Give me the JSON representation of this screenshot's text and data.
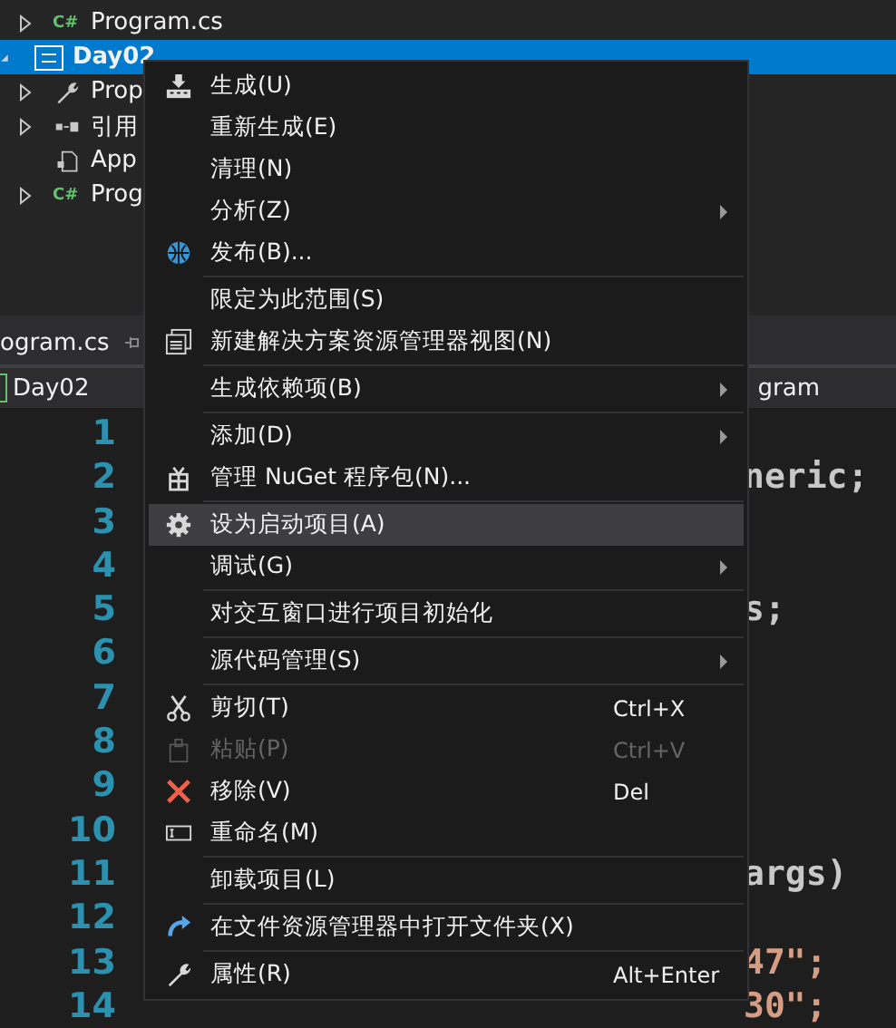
{
  "solution_tree": [
    {
      "label": "Program.cs",
      "kind": "csfile",
      "badge": "C#",
      "expanded": false,
      "selected": false
    },
    {
      "label": "Day02",
      "kind": "project",
      "expanded": true,
      "selected": true,
      "children": [
        {
          "label": "Prop",
          "kind": "properties",
          "expanded": false,
          "selected": false
        },
        {
          "label": "引用",
          "kind": "references",
          "expanded": false,
          "selected": false
        },
        {
          "label": "App",
          "kind": "config",
          "selected": false
        },
        {
          "label": "Prog",
          "kind": "csfile",
          "badge": "C#",
          "expanded": false,
          "selected": false
        }
      ]
    }
  ],
  "editor_tab": {
    "label": "ogram.cs"
  },
  "nav_bar": {
    "project": "Day02",
    "member": "gram"
  },
  "code_lines": [
    {
      "number": "1"
    },
    {
      "number": "2",
      "text": "neric;",
      "kind": "plain"
    },
    {
      "number": "3"
    },
    {
      "number": "4"
    },
    {
      "number": "5",
      "text": "s;",
      "kind": "plain"
    },
    {
      "number": "6"
    },
    {
      "number": "7"
    },
    {
      "number": "8"
    },
    {
      "number": "9"
    },
    {
      "number": "10"
    },
    {
      "number": "11",
      "text": "args)",
      "kind": "plain"
    },
    {
      "number": "12"
    },
    {
      "number": "13",
      "text": "47\";",
      "kind": "string"
    },
    {
      "number": "14",
      "text": "30\";",
      "kind": "string"
    }
  ],
  "context_menu": [
    {
      "kind": "item",
      "label": "生成(U)",
      "submenu": false,
      "disabled": false,
      "selected": false
    },
    {
      "kind": "item",
      "label": "重新生成(E)",
      "submenu": false,
      "disabled": false,
      "selected": false
    },
    {
      "kind": "item",
      "label": "清理(N)",
      "submenu": false,
      "disabled": false,
      "selected": false
    },
    {
      "kind": "item",
      "label": "分析(Z)",
      "submenu": true,
      "disabled": false,
      "selected": false
    },
    {
      "kind": "item",
      "label": "发布(B)...",
      "submenu": false,
      "disabled": false,
      "selected": false
    },
    {
      "kind": "separator"
    },
    {
      "kind": "item",
      "label": "限定为此范围(S)",
      "submenu": false,
      "disabled": false,
      "selected": false
    },
    {
      "kind": "item",
      "label": "新建解决方案资源管理器视图(N)",
      "submenu": false,
      "disabled": false,
      "selected": false
    },
    {
      "kind": "separator"
    },
    {
      "kind": "item",
      "label": "生成依赖项(B)",
      "submenu": true,
      "disabled": false,
      "selected": false
    },
    {
      "kind": "separator"
    },
    {
      "kind": "item",
      "label": "添加(D)",
      "submenu": true,
      "disabled": false,
      "selected": false
    },
    {
      "kind": "item",
      "label": "管理 NuGet 程序包(N)...",
      "submenu": false,
      "disabled": false,
      "selected": false
    },
    {
      "kind": "separator"
    },
    {
      "kind": "item",
      "label": "设为启动项目(A)",
      "submenu": false,
      "disabled": false,
      "selected": true
    },
    {
      "kind": "item",
      "label": "调试(G)",
      "submenu": true,
      "disabled": false,
      "selected": false
    },
    {
      "kind": "separator"
    },
    {
      "kind": "item",
      "label": "对交互窗口进行项目初始化",
      "submenu": false,
      "disabled": false,
      "selected": false
    },
    {
      "kind": "separator"
    },
    {
      "kind": "item",
      "label": "源代码管理(S)",
      "submenu": true,
      "disabled": false,
      "selected": false
    },
    {
      "kind": "separator"
    },
    {
      "kind": "item",
      "label": "剪切(T)",
      "shortcut": "Ctrl+X",
      "submenu": false,
      "disabled": false,
      "selected": false
    },
    {
      "kind": "item",
      "label": "粘贴(P)",
      "shortcut": "Ctrl+V",
      "submenu": false,
      "disabled": true,
      "selected": false
    },
    {
      "kind": "item",
      "label": "移除(V)",
      "shortcut": "Del",
      "submenu": false,
      "disabled": false,
      "selected": false
    },
    {
      "kind": "item",
      "label": "重命名(M)",
      "submenu": false,
      "disabled": false,
      "selected": false
    },
    {
      "kind": "separator"
    },
    {
      "kind": "item",
      "label": "卸载项目(L)",
      "submenu": false,
      "disabled": false,
      "selected": false
    },
    {
      "kind": "separator"
    },
    {
      "kind": "item",
      "label": "在文件资源管理器中打开文件夹(X)",
      "submenu": false,
      "disabled": false,
      "selected": false
    },
    {
      "kind": "separator"
    },
    {
      "kind": "item",
      "label": "属性(R)",
      "shortcut": "Alt+Enter",
      "submenu": false,
      "disabled": false,
      "selected": false
    }
  ]
}
